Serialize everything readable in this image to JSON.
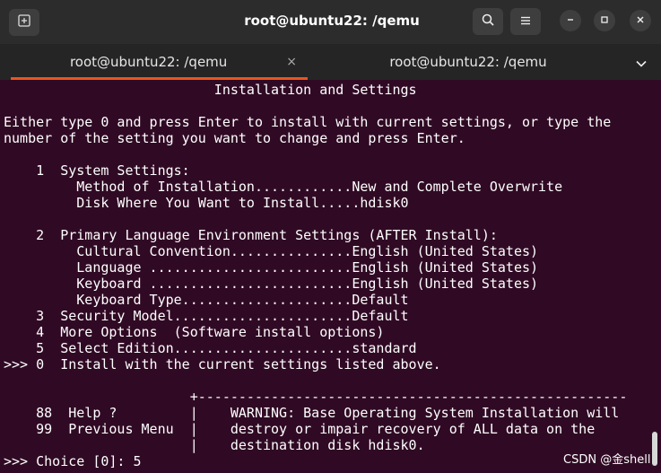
{
  "window": {
    "title": "root@ubuntu22: /qemu",
    "icons": {
      "new_tab": "new-tab-icon",
      "search": "search-icon",
      "menu": "hamburger-menu-icon",
      "minimize": "minimize-icon",
      "maximize": "maximize-icon",
      "close": "close-icon"
    }
  },
  "tabs": [
    {
      "label": "root@ubuntu22: /qemu",
      "active": true,
      "close": "×"
    },
    {
      "label": "root@ubuntu22: /qemu",
      "active": false,
      "close": "×"
    }
  ],
  "tabs_dropdown": "⌄",
  "colors": {
    "terminal_bg": "#300a24",
    "accent": "#e95420",
    "titlebar_bg": "#2c2c2c",
    "text": "#ffffff"
  },
  "terminal": {
    "lines": [
      "                          Installation and Settings",
      "",
      "Either type 0 and press Enter to install with current settings, or type the",
      "number of the setting you want to change and press Enter.",
      "",
      "    1  System Settings:",
      "         Method of Installation............New and Complete Overwrite",
      "         Disk Where You Want to Install.....hdisk0",
      "",
      "    2  Primary Language Environment Settings (AFTER Install):",
      "         Cultural Convention...............English (United States)",
      "         Language .........................English (United States)",
      "         Keyboard .........................English (United States)",
      "         Keyboard Type.....................Default",
      "    3  Security Model......................Default",
      "    4  More Options  (Software install options)",
      "    5  Select Edition......................standard",
      ">>> 0  Install with the current settings listed above.",
      "",
      "                       +-----------------------------------------------------",
      "    88  Help ?         |    WARNING: Base Operating System Installation will",
      "    99  Previous Menu  |    destroy or impair recovery of ALL data on the",
      "                       |    destination disk hdisk0.",
      ">>> Choice [0]: 5"
    ]
  },
  "watermark": "CSDN @金shell"
}
